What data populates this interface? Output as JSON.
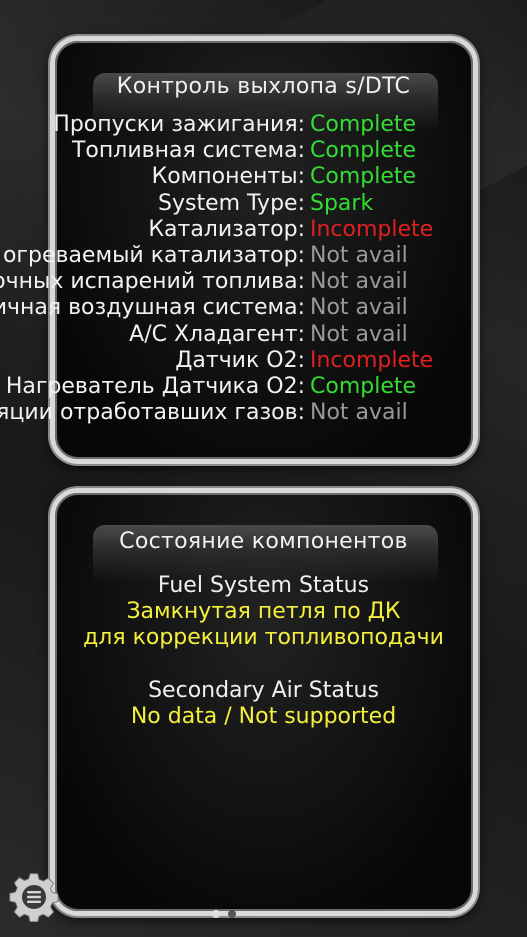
{
  "colors": {
    "complete": "#33dd33",
    "incomplete": "#e02020",
    "not_avail": "#9a9a9a",
    "status_value": "#f5f03c"
  },
  "monitors": {
    "title": "Контроль выхлопа s/DTC",
    "rows": [
      {
        "label": "Пропуски зажигания:",
        "value": "Complete",
        "status": "complete"
      },
      {
        "label": "Топливная система:",
        "value": "Complete",
        "status": "complete"
      },
      {
        "label": "Компоненты:",
        "value": "Complete",
        "status": "complete"
      },
      {
        "label": "System Type:",
        "value": "Spark",
        "status": "complete"
      },
      {
        "label": "Катализатор:",
        "value": "Incomplete",
        "status": "incomplete"
      },
      {
        "label": "огреваемый катализатор:",
        "value": "Not avail",
        "status": "not_avail"
      },
      {
        "label": "очных испарений топлива:",
        "value": "Not avail",
        "status": "not_avail"
      },
      {
        "label": "ичная воздушная система:",
        "value": "Not avail",
        "status": "not_avail"
      },
      {
        "label": "A/C Хладагент:",
        "value": "Not avail",
        "status": "not_avail"
      },
      {
        "label": "Датчик O2:",
        "value": "Incomplete",
        "status": "incomplete"
      },
      {
        "label": "Нагреватель Датчика O2:",
        "value": "Complete",
        "status": "complete"
      },
      {
        "label": "яции отработавших газов:",
        "value": "Not avail",
        "status": "not_avail"
      }
    ]
  },
  "components": {
    "title": "Состояние компонентов",
    "fuel_system_label": "Fuel System Status",
    "fuel_system_value_line1": "Замкнутая петля по ДК",
    "fuel_system_value_line2": "для коррекции топливоподачи",
    "secondary_air_label": "Secondary Air Status",
    "secondary_air_value": "No data / Not supported"
  },
  "icons": {
    "settings": "gear-menu-icon"
  },
  "pager": {
    "page_count": 2,
    "current_page": 1
  }
}
